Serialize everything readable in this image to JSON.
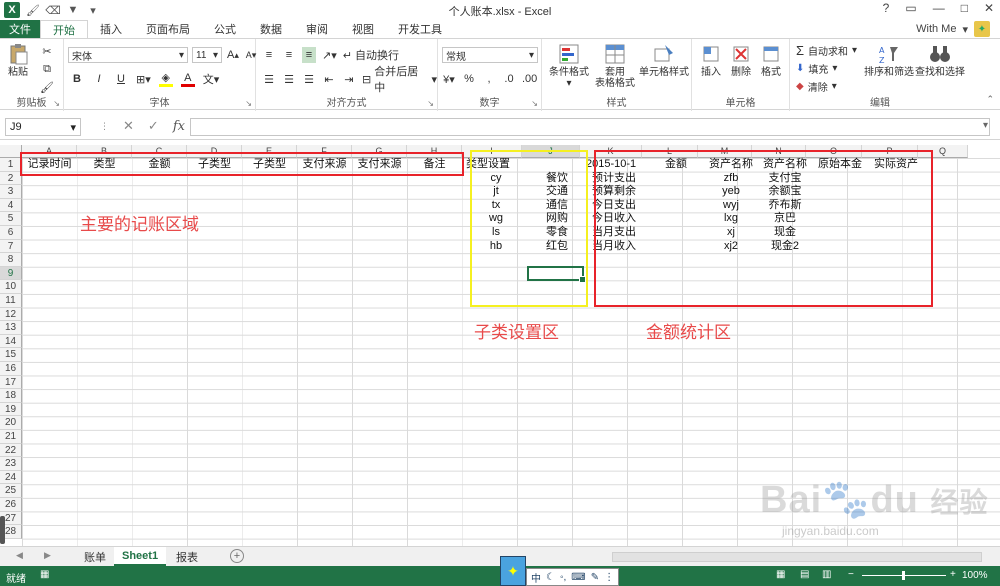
{
  "window": {
    "title": "个人账本.xlsx - Excel",
    "help": "?",
    "restore": "▭",
    "minimize": "—",
    "maximize": "□",
    "close": "✕"
  },
  "ribbon_tabs": [
    "文件",
    "开始",
    "插入",
    "页面布局",
    "公式",
    "数据",
    "审阅",
    "视图",
    "开发工具"
  ],
  "active_tab": "开始",
  "user": {
    "name": "With Me"
  },
  "clipboard": {
    "paste": "粘贴",
    "label": "剪贴板"
  },
  "font": {
    "name": "宋体",
    "size": "11",
    "bold": "B",
    "italic": "I",
    "underline": "U",
    "grow": "A",
    "shrink": "A",
    "label": "字体"
  },
  "alignment": {
    "wrap": "自动换行",
    "merge": "合并后居中",
    "label": "对齐方式"
  },
  "number": {
    "format": "常规",
    "percent": "%",
    "comma": ",",
    "label": "数字"
  },
  "styles": {
    "conditional": "条件格式",
    "table_line1": "套用",
    "table_line2": "表格格式",
    "cell_styles": "单元格样式",
    "label": "样式"
  },
  "cells_group": {
    "insert": "插入",
    "delete": "删除",
    "format": "格式",
    "label": "单元格"
  },
  "editing": {
    "autosum": "自动求和",
    "fill": "填充",
    "clear": "清除",
    "sort": "排序和筛选",
    "find": "查找和选择",
    "label": "编辑"
  },
  "formula_bar": {
    "name_box": "J9",
    "fx": "fx"
  },
  "columns": [
    "A",
    "B",
    "C",
    "D",
    "E",
    "F",
    "G",
    "H",
    "I",
    "J",
    "K",
    "L",
    "M",
    "N",
    "O",
    "P",
    "Q"
  ],
  "rows": [
    "1",
    "2",
    "3",
    "4",
    "5",
    "6",
    "7",
    "8",
    "9",
    "10",
    "11",
    "12",
    "13",
    "14",
    "15",
    "16",
    "17",
    "18",
    "19",
    "20",
    "21",
    "22",
    "23",
    "24",
    "25",
    "26",
    "27",
    "28"
  ],
  "header_row": [
    "记录时间",
    "类型",
    "金额",
    "子类型",
    "子类型",
    "支付来源",
    "支付来源",
    "备注"
  ],
  "subtype_header": "类型设置",
  "subtype_codes": [
    "cy",
    "jt",
    "tx",
    "wg",
    "ls",
    "hb"
  ],
  "subtype_names": [
    "餐饮",
    "交通",
    "通信",
    "网购",
    "零食",
    "红包"
  ],
  "stats_header": [
    "2015-10-1",
    "金额",
    "资产名称",
    "资产名称",
    "原始本金",
    "实际资产"
  ],
  "stats_labels": [
    "预计支出",
    "预算剩余",
    "今日支出",
    "今日收入",
    "当月支出",
    "当月收入"
  ],
  "asset_codes": [
    "zfb",
    "yeb",
    "wyj",
    "lxg",
    "xj",
    "xj2"
  ],
  "asset_names": [
    "支付宝",
    "余额宝",
    "乔布斯",
    "京巴",
    "现金",
    "现金2"
  ],
  "annotations": {
    "main_area": "主要的记账区域",
    "subtype_area": "子类设置区",
    "stats_area": "金额统计区"
  },
  "sheet_tabs": [
    "账单",
    "Sheet1",
    "报表"
  ],
  "active_sheet": "Sheet1",
  "status": {
    "ready": "就绪",
    "zoom": "100%"
  },
  "ime": {
    "mode": "中"
  },
  "watermark": {
    "brand": "Bai",
    "brand2": "du",
    "cn": "经验",
    "url": "jingyan.baidu.com"
  },
  "colors": {
    "excel_green": "#217346",
    "red_box": "#e8232a",
    "yellow_box": "#f5f020",
    "annotation": "#e84a4a"
  }
}
